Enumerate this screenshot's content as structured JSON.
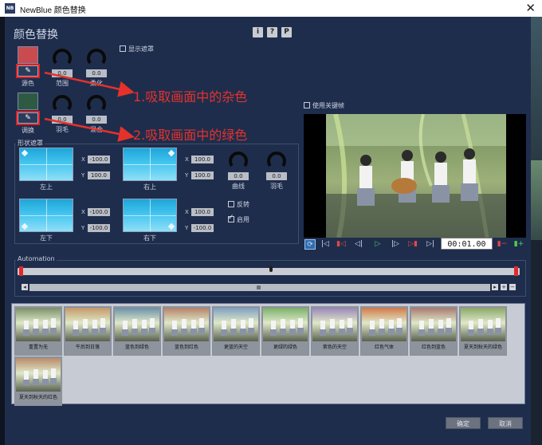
{
  "window": {
    "app_logo_text": "NB",
    "title": "NewBlue 颜色替换",
    "close_glyph": "✕"
  },
  "dialog": {
    "title": "颜色替换",
    "header_buttons": [
      "i",
      "?",
      "P"
    ]
  },
  "colors": {
    "source_color": "#c94b4f",
    "replace_color": "#2e5a43",
    "accent_red": "#e4322b",
    "highlight_box": "#e02020"
  },
  "source": {
    "label": "源色",
    "range_label": "范围",
    "range_value": "0.0",
    "smooth_label": "柔化",
    "smooth_value": "0.0",
    "show_mask_label": "显示遮罩"
  },
  "replace": {
    "label": "调换",
    "feather_label": "羽毛",
    "feather_value": "0.0",
    "blend_label": "混合",
    "blend_value": "0.0"
  },
  "annotations": {
    "step1": "1.吸取画面中的杂色",
    "step2": "2.吸取画面中的绿色"
  },
  "keyframe": {
    "label": "使用关键帧"
  },
  "shape_mask": {
    "title": "形状遮罩",
    "top_left": {
      "label": "左上",
      "x": "-100.0",
      "y": "100.0"
    },
    "top_right": {
      "label": "右上",
      "x": "100.0",
      "y": "100.0"
    },
    "bottom_left": {
      "label": "左下",
      "x": "-100.0",
      "y": "-100.0"
    },
    "bottom_right": {
      "label": "右下",
      "x": "100.0",
      "y": "-100.0"
    },
    "curve_label": "曲线",
    "curve_value": "0.0",
    "feather_label": "羽毛",
    "feather_value": "0.0",
    "invert_label": "反转",
    "enable_label": "启用",
    "axis_x": "X",
    "axis_y": "Y"
  },
  "transport": {
    "timecode": "00:01.00",
    "buttons": [
      "loop-icon",
      "go-start-icon",
      "prev-keyframe-icon",
      "step-back-icon",
      "play-icon",
      "step-forward-icon",
      "next-keyframe-icon",
      "go-end-icon",
      "remove-keyframe-icon",
      "add-keyframe-icon"
    ]
  },
  "automation": {
    "title": "Automation",
    "plus": "+",
    "minus": "−"
  },
  "presets": [
    {
      "label": "重置为无"
    },
    {
      "label": "午后到日落"
    },
    {
      "label": "蓝色到绿色"
    },
    {
      "label": "蓝色到红色"
    },
    {
      "label": "更蓝的天空"
    },
    {
      "label": "更绿的绿色"
    },
    {
      "label": "紫色的天空"
    },
    {
      "label": "红色气体"
    },
    {
      "label": "红色到蓝色"
    },
    {
      "label": "夏天到秋天的绿色"
    },
    {
      "label": "夏天到秋天的红色"
    }
  ],
  "footer": {
    "ok_label": "确定",
    "cancel_label": "取消"
  }
}
